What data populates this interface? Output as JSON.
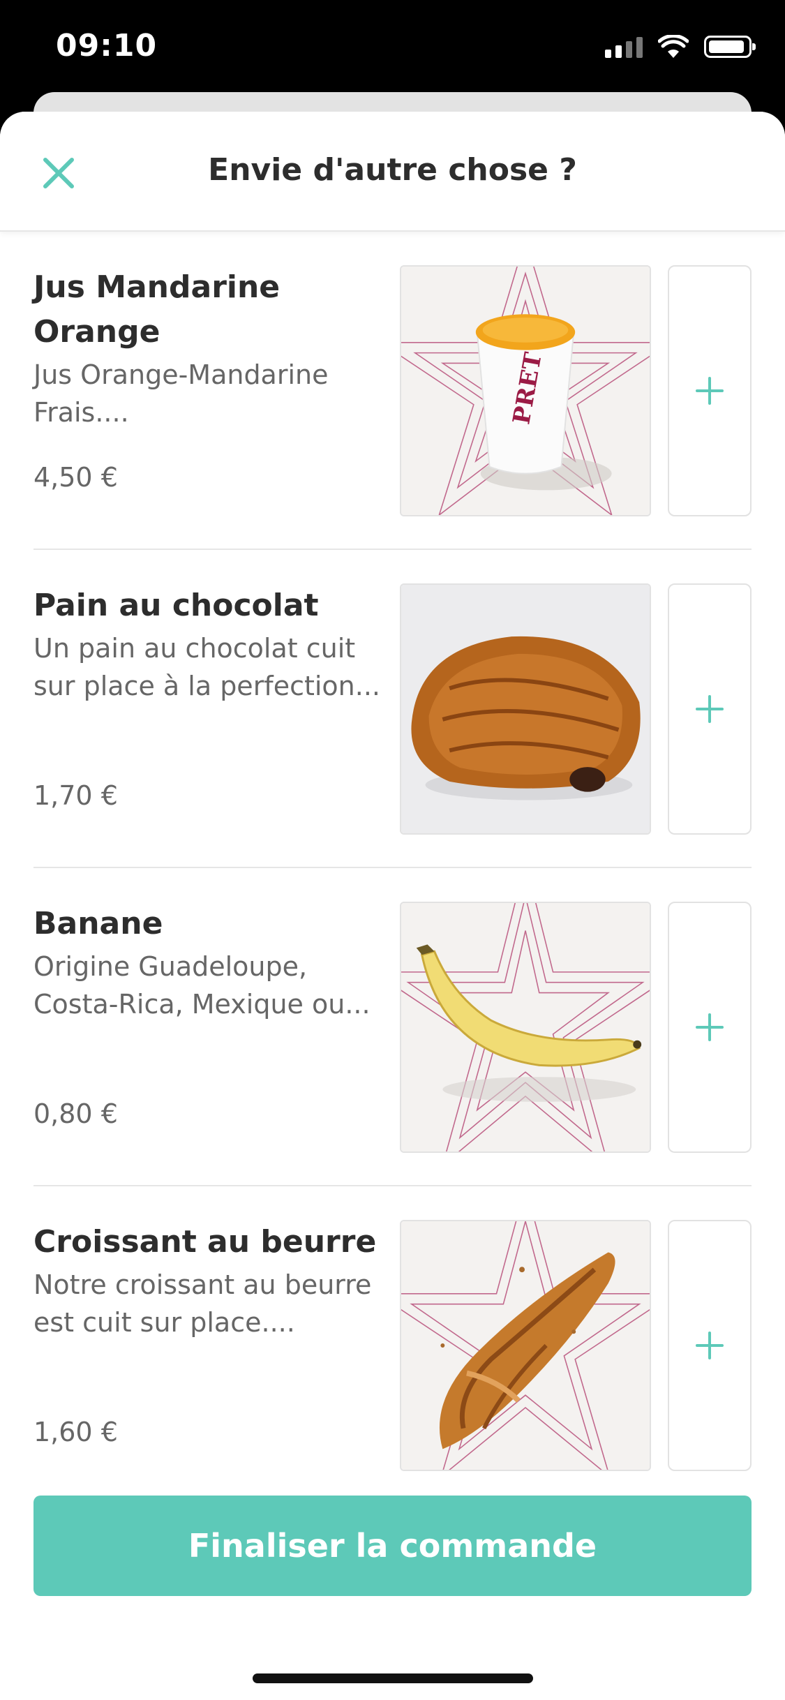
{
  "status_bar": {
    "time": "09:10"
  },
  "sheet": {
    "title": "Envie d'autre chose ?"
  },
  "items": [
    {
      "name": "Jus Mandarine Orange",
      "description": "Jus Orange-Mandarine Frais....",
      "price": "4,50 €",
      "image": "orange-juice-cup-image",
      "cup_text": "PRET"
    },
    {
      "name": "Pain au chocolat",
      "description": "Un pain au chocolat cuit sur place à la perfection...",
      "price": "1,70 €",
      "image": "pain-au-chocolat-image"
    },
    {
      "name": "Banane",
      "description": "Origine Guadeloupe, Costa-Rica, Mexique ou...",
      "price": "0,80 €",
      "image": "banana-image"
    },
    {
      "name": "Croissant au beurre",
      "description": "Notre croissant au beurre est cuit sur place....",
      "price": "1,60 €",
      "image": "croissant-image"
    }
  ],
  "add_label": "+",
  "checkout": {
    "label": "Finaliser la commande"
  },
  "colors": {
    "accent": "#5dc9b8",
    "text": "#2d2d2d",
    "muted": "#666666",
    "star_lines": "#b03a6b"
  }
}
